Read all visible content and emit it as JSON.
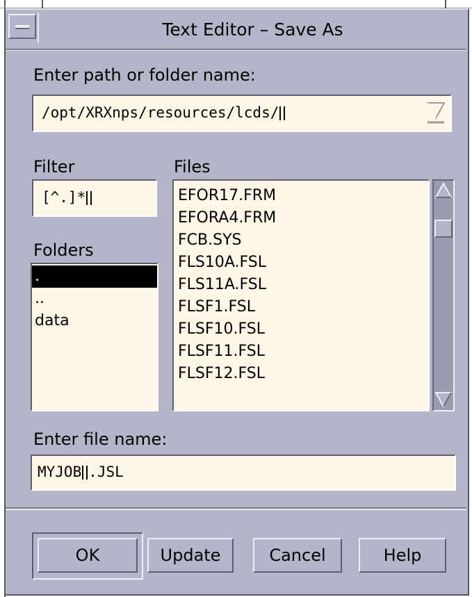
{
  "window": {
    "title": "Text Editor – Save As"
  },
  "path": {
    "label": "Enter path or folder name:",
    "value": "/opt/XRXnps/resources/lcds/"
  },
  "filter": {
    "label": "Filter",
    "value": "[^.]*"
  },
  "files": {
    "label": "Files",
    "items": [
      "EFOR17.FRM",
      "EFORA4.FRM",
      "FCB.SYS",
      "FLS10A.FSL",
      "FLS11A.FSL",
      "FLSF1.FSL",
      "FLSF10.FSL",
      "FLSF11.FSL",
      "FLSF12.FSL"
    ]
  },
  "folders": {
    "label": "Folders",
    "items": [
      ".",
      "..",
      "data"
    ],
    "selected_index": 0
  },
  "filename": {
    "label": "Enter file name:",
    "value_before_cursor": "MYJOB",
    "value_after_cursor": ".JSL"
  },
  "buttons": {
    "ok": "OK",
    "update": "Update",
    "cancel": "Cancel",
    "help": "Help"
  },
  "colors": {
    "dialog_bg": "#b4b5c8",
    "field_bg": "#fdf6e6",
    "selection_bg": "#000000"
  }
}
